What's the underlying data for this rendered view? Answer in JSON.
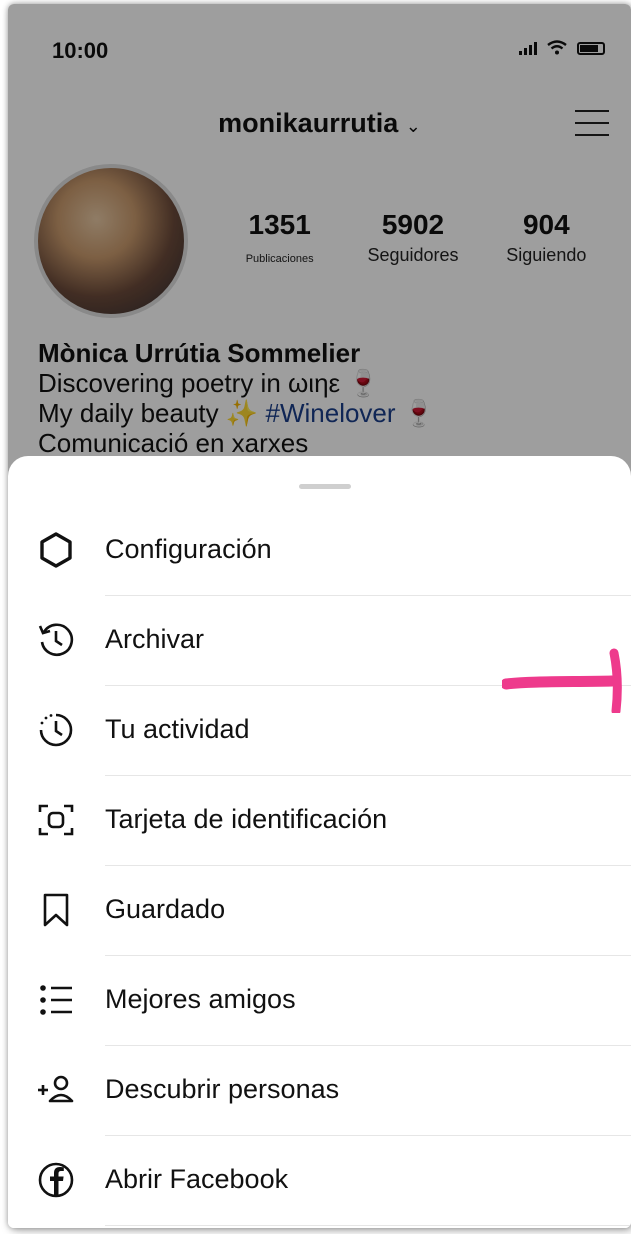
{
  "status": {
    "time": "10:00"
  },
  "profile": {
    "username": "monikaurrutia",
    "stats": [
      {
        "value": "1351",
        "label": "Publicaciones"
      },
      {
        "value": "5902",
        "label": "Seguidores"
      },
      {
        "value": "904",
        "label": "Siguiendo"
      }
    ],
    "bio_name": "Mònica Urrútia Sommelier",
    "bio_line1": "Discovering poetry in ωιηε",
    "bio_line2_prefix": "My daily beauty",
    "bio_hashtag": "#Winelover",
    "bio_line3": "Comunicació en xarxes"
  },
  "menu": {
    "items": [
      {
        "label": "Configuración",
        "icon": "settings-icon"
      },
      {
        "label": "Archivar",
        "icon": "archive-icon"
      },
      {
        "label": "Tu actividad",
        "icon": "activity-icon"
      },
      {
        "label": "Tarjeta de identificación",
        "icon": "nametag-icon"
      },
      {
        "label": "Guardado",
        "icon": "bookmark-icon"
      },
      {
        "label": "Mejores amigos",
        "icon": "close-friends-icon"
      },
      {
        "label": "Descubrir personas",
        "icon": "add-person-icon"
      },
      {
        "label": "Abrir Facebook",
        "icon": "facebook-icon"
      }
    ]
  },
  "colors": {
    "annotation_arrow": "#ee3a8c",
    "hashtag": "#1b3e8a",
    "overlay": "rgba(0,0,0,0.38)"
  }
}
